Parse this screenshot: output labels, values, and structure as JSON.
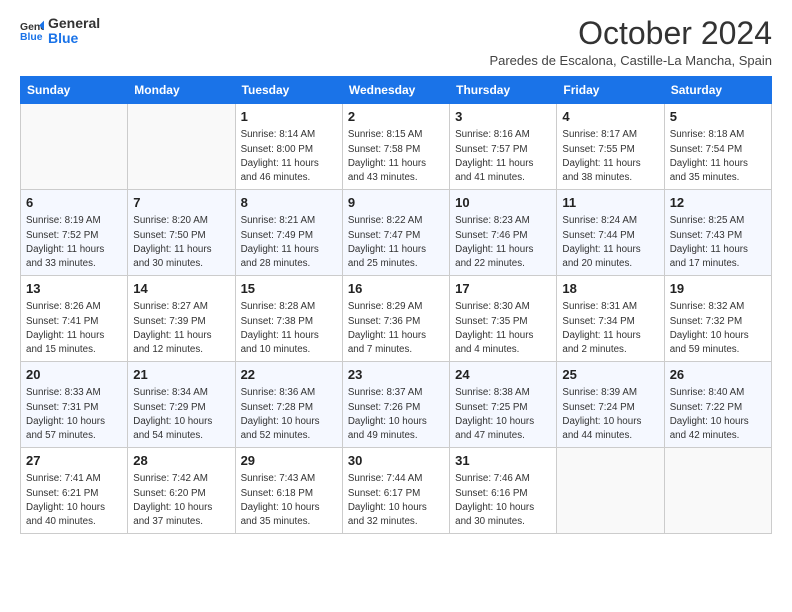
{
  "header": {
    "logo_line1": "General",
    "logo_line2": "Blue",
    "month_title": "October 2024",
    "subtitle": "Paredes de Escalona, Castille-La Mancha, Spain"
  },
  "days_of_week": [
    "Sunday",
    "Monday",
    "Tuesday",
    "Wednesday",
    "Thursday",
    "Friday",
    "Saturday"
  ],
  "weeks": [
    [
      {
        "day": "",
        "info": ""
      },
      {
        "day": "",
        "info": ""
      },
      {
        "day": "1",
        "info": "Sunrise: 8:14 AM\nSunset: 8:00 PM\nDaylight: 11 hours and 46 minutes."
      },
      {
        "day": "2",
        "info": "Sunrise: 8:15 AM\nSunset: 7:58 PM\nDaylight: 11 hours and 43 minutes."
      },
      {
        "day": "3",
        "info": "Sunrise: 8:16 AM\nSunset: 7:57 PM\nDaylight: 11 hours and 41 minutes."
      },
      {
        "day": "4",
        "info": "Sunrise: 8:17 AM\nSunset: 7:55 PM\nDaylight: 11 hours and 38 minutes."
      },
      {
        "day": "5",
        "info": "Sunrise: 8:18 AM\nSunset: 7:54 PM\nDaylight: 11 hours and 35 minutes."
      }
    ],
    [
      {
        "day": "6",
        "info": "Sunrise: 8:19 AM\nSunset: 7:52 PM\nDaylight: 11 hours and 33 minutes."
      },
      {
        "day": "7",
        "info": "Sunrise: 8:20 AM\nSunset: 7:50 PM\nDaylight: 11 hours and 30 minutes."
      },
      {
        "day": "8",
        "info": "Sunrise: 8:21 AM\nSunset: 7:49 PM\nDaylight: 11 hours and 28 minutes."
      },
      {
        "day": "9",
        "info": "Sunrise: 8:22 AM\nSunset: 7:47 PM\nDaylight: 11 hours and 25 minutes."
      },
      {
        "day": "10",
        "info": "Sunrise: 8:23 AM\nSunset: 7:46 PM\nDaylight: 11 hours and 22 minutes."
      },
      {
        "day": "11",
        "info": "Sunrise: 8:24 AM\nSunset: 7:44 PM\nDaylight: 11 hours and 20 minutes."
      },
      {
        "day": "12",
        "info": "Sunrise: 8:25 AM\nSunset: 7:43 PM\nDaylight: 11 hours and 17 minutes."
      }
    ],
    [
      {
        "day": "13",
        "info": "Sunrise: 8:26 AM\nSunset: 7:41 PM\nDaylight: 11 hours and 15 minutes."
      },
      {
        "day": "14",
        "info": "Sunrise: 8:27 AM\nSunset: 7:39 PM\nDaylight: 11 hours and 12 minutes."
      },
      {
        "day": "15",
        "info": "Sunrise: 8:28 AM\nSunset: 7:38 PM\nDaylight: 11 hours and 10 minutes."
      },
      {
        "day": "16",
        "info": "Sunrise: 8:29 AM\nSunset: 7:36 PM\nDaylight: 11 hours and 7 minutes."
      },
      {
        "day": "17",
        "info": "Sunrise: 8:30 AM\nSunset: 7:35 PM\nDaylight: 11 hours and 4 minutes."
      },
      {
        "day": "18",
        "info": "Sunrise: 8:31 AM\nSunset: 7:34 PM\nDaylight: 11 hours and 2 minutes."
      },
      {
        "day": "19",
        "info": "Sunrise: 8:32 AM\nSunset: 7:32 PM\nDaylight: 10 hours and 59 minutes."
      }
    ],
    [
      {
        "day": "20",
        "info": "Sunrise: 8:33 AM\nSunset: 7:31 PM\nDaylight: 10 hours and 57 minutes."
      },
      {
        "day": "21",
        "info": "Sunrise: 8:34 AM\nSunset: 7:29 PM\nDaylight: 10 hours and 54 minutes."
      },
      {
        "day": "22",
        "info": "Sunrise: 8:36 AM\nSunset: 7:28 PM\nDaylight: 10 hours and 52 minutes."
      },
      {
        "day": "23",
        "info": "Sunrise: 8:37 AM\nSunset: 7:26 PM\nDaylight: 10 hours and 49 minutes."
      },
      {
        "day": "24",
        "info": "Sunrise: 8:38 AM\nSunset: 7:25 PM\nDaylight: 10 hours and 47 minutes."
      },
      {
        "day": "25",
        "info": "Sunrise: 8:39 AM\nSunset: 7:24 PM\nDaylight: 10 hours and 44 minutes."
      },
      {
        "day": "26",
        "info": "Sunrise: 8:40 AM\nSunset: 7:22 PM\nDaylight: 10 hours and 42 minutes."
      }
    ],
    [
      {
        "day": "27",
        "info": "Sunrise: 7:41 AM\nSunset: 6:21 PM\nDaylight: 10 hours and 40 minutes."
      },
      {
        "day": "28",
        "info": "Sunrise: 7:42 AM\nSunset: 6:20 PM\nDaylight: 10 hours and 37 minutes."
      },
      {
        "day": "29",
        "info": "Sunrise: 7:43 AM\nSunset: 6:18 PM\nDaylight: 10 hours and 35 minutes."
      },
      {
        "day": "30",
        "info": "Sunrise: 7:44 AM\nSunset: 6:17 PM\nDaylight: 10 hours and 32 minutes."
      },
      {
        "day": "31",
        "info": "Sunrise: 7:46 AM\nSunset: 6:16 PM\nDaylight: 10 hours and 30 minutes."
      },
      {
        "day": "",
        "info": ""
      },
      {
        "day": "",
        "info": ""
      }
    ]
  ]
}
